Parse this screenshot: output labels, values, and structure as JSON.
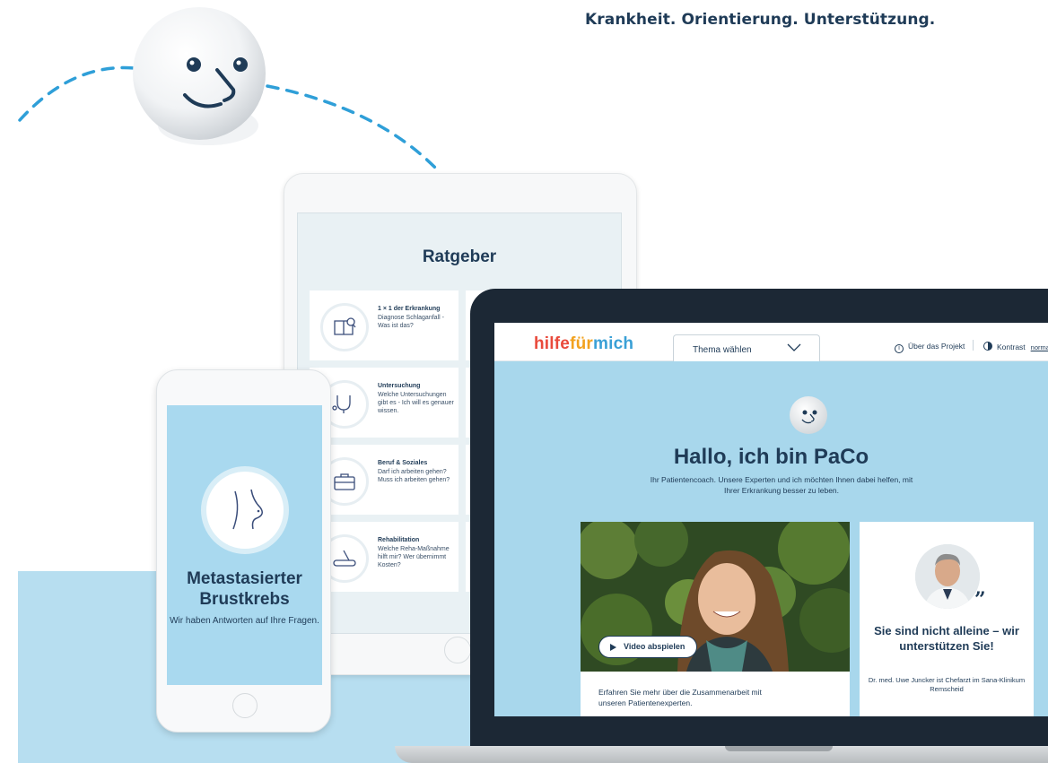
{
  "tagline": "Krankheit. Orientierung. Unterstützung.",
  "tablet": {
    "title": "Ratgeber",
    "cards": [
      {
        "title": "1 × 1 der Erkrankung",
        "text": "Diagnose Schlaganfall - Was ist das?",
        "icon": "book-search-icon"
      },
      {
        "title": "Untersuchung",
        "text": "Welche Untersuchungen gibt es - Ich will es genauer wissen.",
        "icon": "stethoscope-icon"
      },
      {
        "title": "Beruf & Soziales",
        "text": "Darf ich arbeiten gehen? Muss ich arbeiten gehen?",
        "icon": "briefcase-icon"
      },
      {
        "title": "Rehabilitation",
        "text": "Welche Reha-Maßnahme hilft mir? Wer übernimmt Kosten?",
        "icon": "treadmill-icon"
      }
    ]
  },
  "phone": {
    "title": "Metastasierter Brustkrebs",
    "subtitle": "Wir haben Antworten auf Ihre Fragen."
  },
  "site": {
    "logo": {
      "part1": "hilfe",
      "part2": "für",
      "part3": "mich"
    },
    "theme_select": "Thema wählen",
    "nav_about": "Über das Projekt",
    "nav_contrast": "Kontrast",
    "nav_contrast_value": "normal",
    "hero_title": "Hallo, ich bin PaCo",
    "hero_subtitle": "Ihr Patientencoach. Unsere Experten und ich möchten Ihnen dabei helfen, mit Ihrer Erkrankung besser zu leben.",
    "video_button": "Video abspielen",
    "video_caption": "Erfahren Sie mehr über die Zusammenarbeit mit unseren Patientenexperten.",
    "quote": "Sie sind nicht alleine – wir unterstützen Sie!",
    "quote_author": "Dr. med. Uwe Juncker ist Chefarzt im Sana-Klinikum Remscheid"
  },
  "colors": {
    "navy": "#1f3b57",
    "light_blue": "#a8d7ec",
    "logo_red": "#e94a3c",
    "logo_orange": "#f2a21f",
    "logo_blue": "#3aa0d6"
  }
}
